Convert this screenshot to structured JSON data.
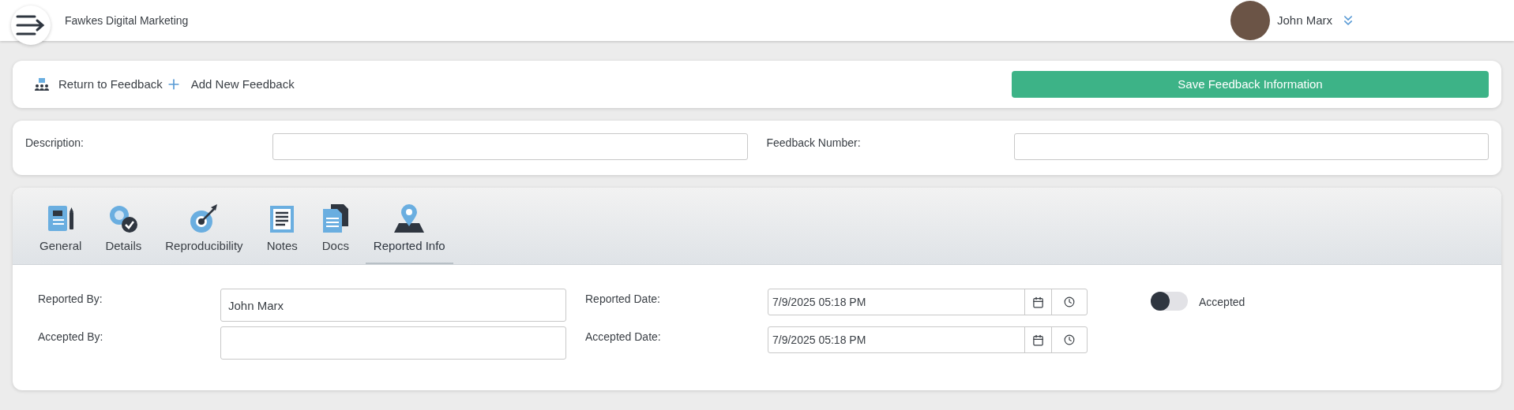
{
  "header": {
    "company": "Fawkes Digital Marketing",
    "user": "John Marx"
  },
  "toolbar": {
    "links": [
      {
        "kind": "return",
        "label": "Return to Feedback"
      },
      {
        "kind": "add",
        "label": "Add New Feedback"
      }
    ],
    "save_button": "Save Feedback Information"
  },
  "summary": {
    "fields": [
      {
        "label": "Description:"
      },
      {
        "label": "Feedback Number:"
      }
    ]
  },
  "tabs": [
    {
      "kind": "general",
      "label": "General",
      "selected": false
    },
    {
      "kind": "details",
      "label": "Details",
      "selected": false
    },
    {
      "kind": "repro",
      "label": "Reproducibility",
      "selected": false
    },
    {
      "kind": "notes",
      "label": "Notes",
      "selected": false
    },
    {
      "kind": "docs",
      "label": "Docs",
      "selected": false
    },
    {
      "kind": "reported",
      "label": "Reported Info",
      "selected": true
    }
  ],
  "reported_info": {
    "rows": [
      {
        "name_label": "Reported By:",
        "name_value": "John Marx",
        "date_label": "Reported Date:",
        "date_value": "7/9/2025 05:18 PM"
      },
      {
        "name_label": "Accepted By:",
        "name_value": "",
        "date_label": "Accepted Date:",
        "date_value": "7/9/2025 05:18 PM"
      }
    ],
    "accepted_toggle": {
      "label": "Accepted",
      "on": false
    }
  }
}
